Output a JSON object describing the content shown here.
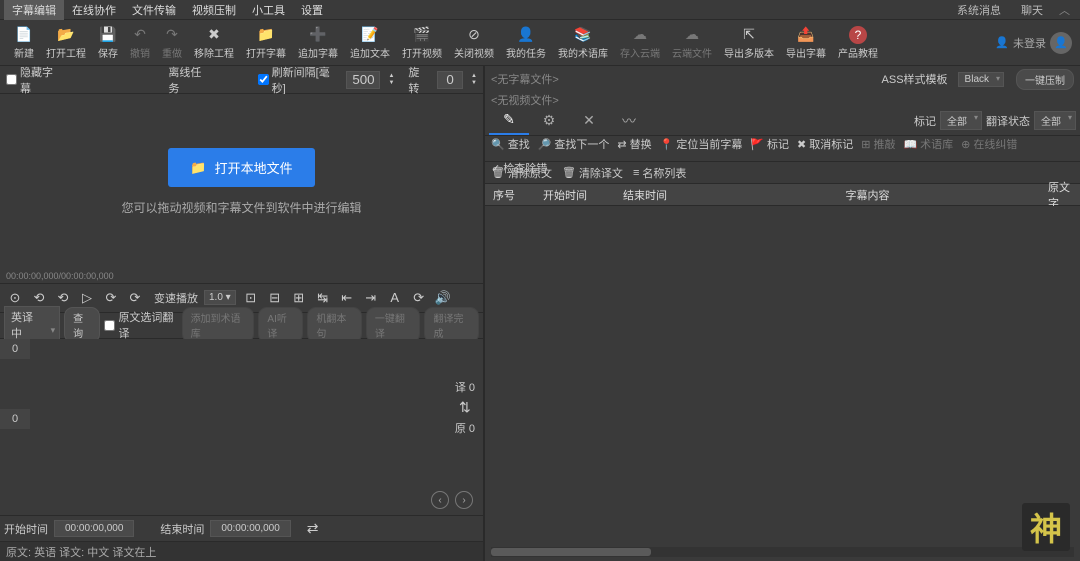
{
  "menubar": {
    "items": [
      "字幕编辑",
      "在线协作",
      "文件传输",
      "视频压制",
      "小工具",
      "设置"
    ],
    "right": [
      "系统消息",
      "聊天"
    ]
  },
  "toolbar": {
    "items": [
      {
        "icon": "📄",
        "label": "新建"
      },
      {
        "icon": "📂",
        "label": "打开工程"
      },
      {
        "icon": "💾",
        "label": "保存"
      },
      {
        "icon": "↶",
        "label": "撤销",
        "dim": true
      },
      {
        "icon": "↷",
        "label": "重做",
        "dim": true
      },
      {
        "icon": "✖",
        "label": "移除工程"
      },
      {
        "icon": "📁",
        "label": "打开字幕"
      },
      {
        "icon": "➕",
        "label": "追加字幕"
      },
      {
        "icon": "📝",
        "label": "追加文本"
      },
      {
        "icon": "🎬",
        "label": "打开视频"
      },
      {
        "icon": "⊘",
        "label": "关闭视频"
      },
      {
        "icon": "👤",
        "label": "我的任务"
      },
      {
        "icon": "📚",
        "label": "我的术语库"
      },
      {
        "icon": "☁",
        "label": "存入云端",
        "dim": true
      },
      {
        "icon": "☁",
        "label": "云端文件",
        "dim": true
      },
      {
        "icon": "⇱",
        "label": "导出多版本"
      },
      {
        "icon": "📤",
        "label": "导出字幕"
      },
      {
        "icon": "?",
        "label": "产品教程",
        "help": true
      }
    ],
    "login": "未登录"
  },
  "left": {
    "hide_sub": "隐藏字幕",
    "offline_task": "离线任务",
    "refresh_label": "刷新间隔[毫秒]",
    "refresh_val": "500",
    "rotate_label": "旋转",
    "rotate_val": "0",
    "open_btn": "打开本地文件",
    "drop_hint": "您可以拖动视频和字幕文件到软件中进行编辑",
    "timecode": "00:00:00,000/00:00:00,000",
    "speed_label": "变速播放",
    "speed_val": "1.0",
    "trans_sel": "英译中",
    "query_btn": "查询",
    "trans_btns": [
      "原文选词翻译",
      "添加到术语库",
      "AI听译",
      "机翻本句",
      "一键翻译",
      "翻译完成"
    ],
    "gutter0": "0",
    "gutter1": "0",
    "swap_yi": "译 0",
    "swap_yuan": "原 0",
    "start_label": "开始时间",
    "start_val": "00:00:00,000",
    "end_label": "结束时间",
    "end_val": "00:00:00,000",
    "status": "原文: 英语  译文: 中文   译文在上"
  },
  "right": {
    "tab1": "<无字幕文件>",
    "tab2": "<无视频文件>",
    "ass_label": "ASS样式模板",
    "ass_val": "Black",
    "compress_btn": "一键压制",
    "mark_label": "标记",
    "mark_val": "全部",
    "trans_state_label": "翻译状态",
    "trans_state_val": "全部",
    "actions": [
      {
        "icon": "🔍",
        "label": "查找"
      },
      {
        "icon": "🔎",
        "label": "查找下一个"
      },
      {
        "icon": "⇄",
        "label": "替换"
      },
      {
        "icon": "📍",
        "label": "定位当前字幕"
      },
      {
        "icon": "🚩",
        "label": "标记"
      },
      {
        "icon": "✖",
        "label": "取消标记"
      },
      {
        "icon": "⊞",
        "label": "推敲",
        "dim": true
      },
      {
        "icon": "📖",
        "label": "术语库",
        "dim": true
      },
      {
        "icon": "⊕",
        "label": "在线纠错",
        "dim": true
      },
      {
        "icon": "✓",
        "label": "检查除错"
      }
    ],
    "actions2": [
      {
        "icon": "🗑",
        "label": "清除原文"
      },
      {
        "icon": "🗑",
        "label": "清除译文"
      },
      {
        "icon": "≡",
        "label": "名称列表"
      }
    ],
    "cols": [
      "序号",
      "开始时间",
      "结束时间",
      "字幕内容",
      "原文字"
    ]
  },
  "logo": "神"
}
